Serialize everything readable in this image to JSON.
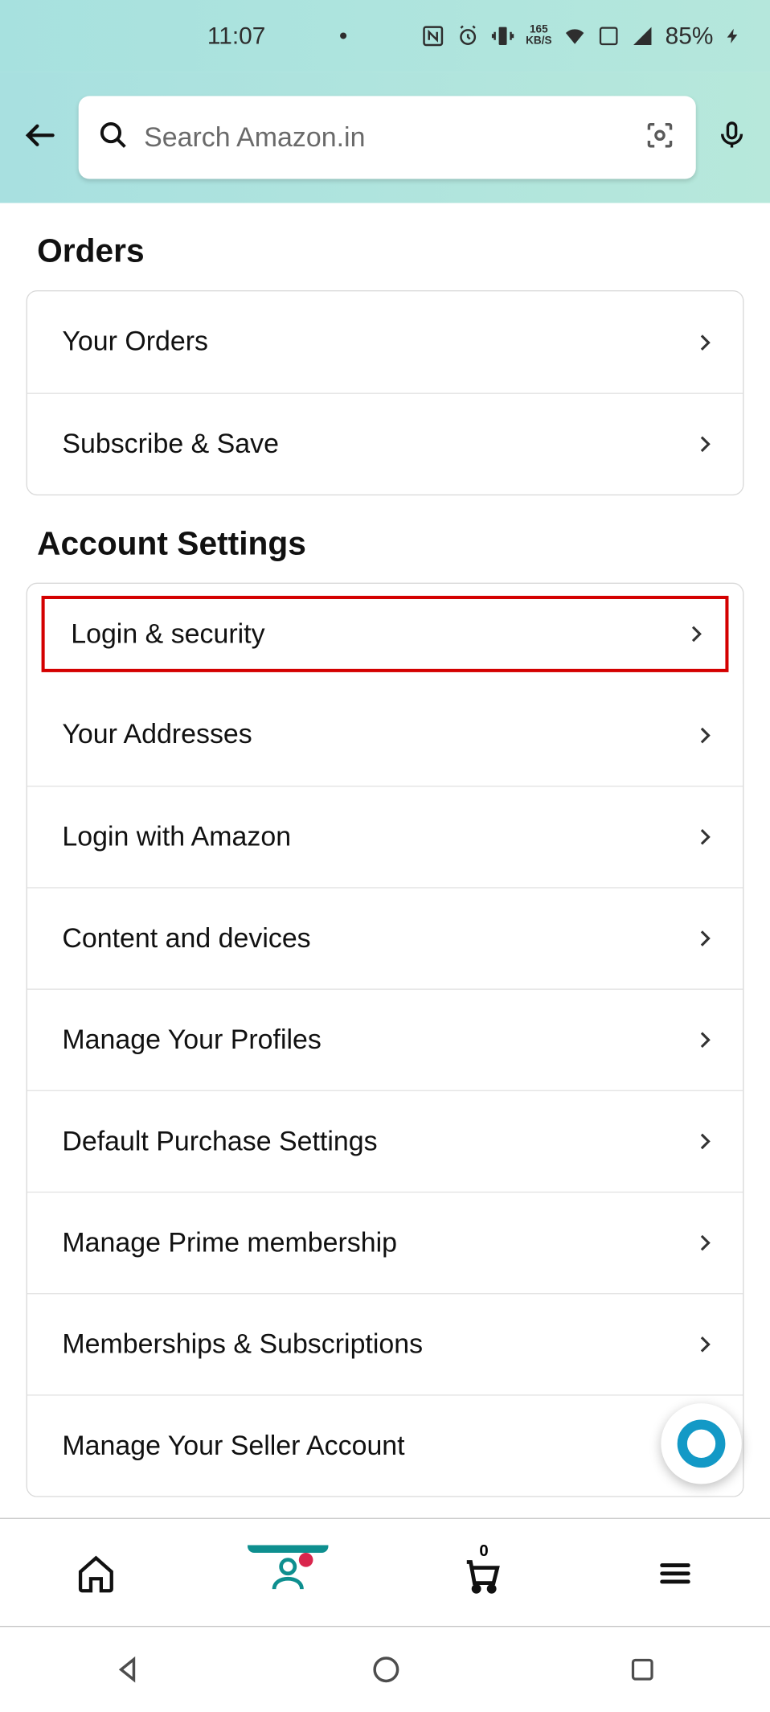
{
  "status": {
    "time": "11:07",
    "netspeed_top": "165",
    "netspeed_bottom": "KB/S",
    "battery": "85%"
  },
  "search": {
    "placeholder": "Search Amazon.in"
  },
  "sections": {
    "orders": {
      "title": "Orders",
      "items": [
        "Your Orders",
        "Subscribe & Save"
      ]
    },
    "account": {
      "title": "Account Settings",
      "items": [
        "Login & security",
        "Your Addresses",
        "Login with Amazon",
        "Content and devices",
        "Manage Your Profiles",
        "Default Purchase Settings",
        "Manage Prime membership",
        "Memberships & Subscriptions",
        "Manage Your Seller Account"
      ]
    }
  },
  "cart": {
    "count": "0"
  }
}
